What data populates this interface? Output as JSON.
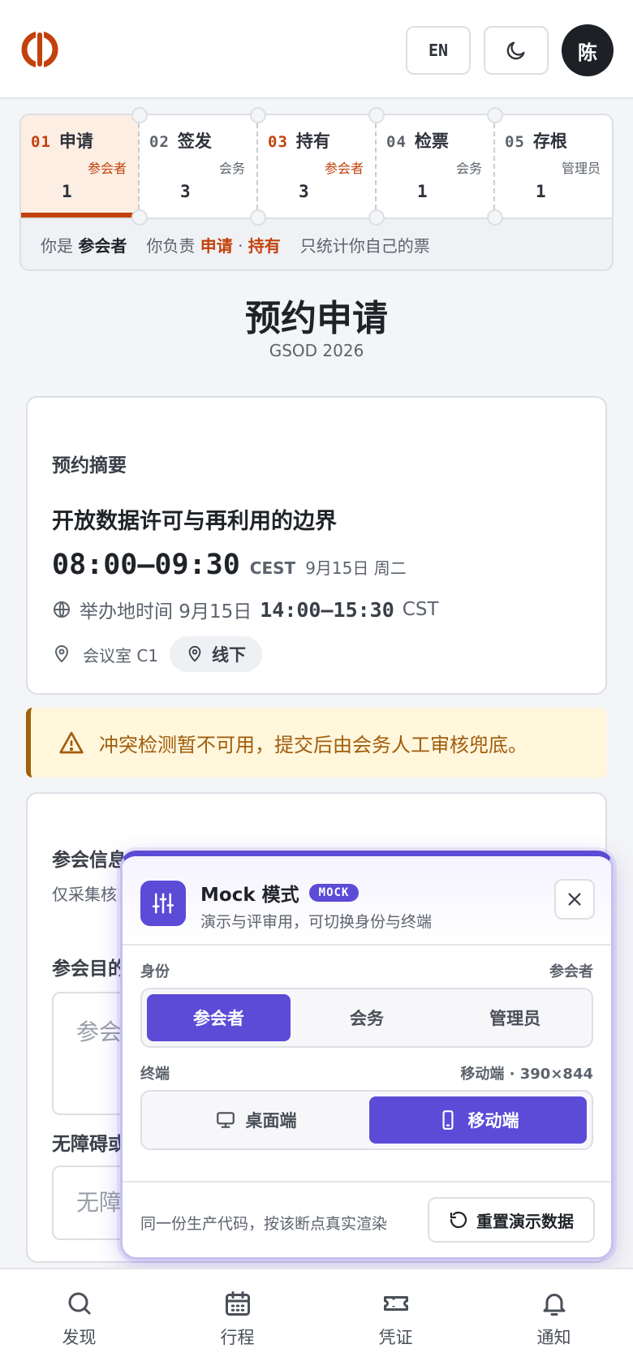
{
  "header": {
    "lang_label": "EN",
    "avatar_initial": "陈"
  },
  "stepper": {
    "steps": [
      {
        "num": "01",
        "name": "申请",
        "role": "参会者",
        "count": "1"
      },
      {
        "num": "02",
        "name": "签发",
        "role": "会务",
        "count": "3"
      },
      {
        "num": "03",
        "name": "持有",
        "role": "参会者",
        "count": "3"
      },
      {
        "num": "04",
        "name": "检票",
        "role": "会务",
        "count": "1"
      },
      {
        "num": "05",
        "name": "存根",
        "role": "管理员",
        "count": "1"
      }
    ],
    "you_are_prefix": "你是",
    "you_are_role": "参会者",
    "responsible_prefix": "你负责",
    "responsible_a": "申请",
    "dot": "·",
    "responsible_b": "持有",
    "note": "只统计你自己的票"
  },
  "page": {
    "title": "预约申请",
    "subtitle": "GSOD 2026"
  },
  "summary": {
    "label": "预约摘要",
    "session_title": "开放数据许可与再利用的边界",
    "time": "08:00–09:30",
    "tz": "CEST",
    "date": "9月15日 周二",
    "host_prefix": "举办地时间 9月15日",
    "host_time": "14:00–15:30",
    "host_tz": "CST",
    "room": "会议室 C1",
    "mode": "线下"
  },
  "warning": {
    "text": "冲突检测暂不可用，提交后由会务人工审核兜底。"
  },
  "form": {
    "section_label": "参会信息",
    "section_help": "仅采集核",
    "purpose_label": "参会目的",
    "purpose_placeholder": "参会",
    "access_label": "无障碍或",
    "access_placeholder": "无障"
  },
  "mock": {
    "title": "Mock 模式",
    "badge": "MOCK",
    "desc": "演示与评审用，可切换身份与终端",
    "identity_label": "身份",
    "identity_value": "参会者",
    "identity_options": [
      "参会者",
      "会务",
      "管理员"
    ],
    "terminal_label": "终端",
    "terminal_value": "移动端 · 390×844",
    "terminal_options": [
      "桌面端",
      "移动端"
    ],
    "foot_text": "同一份生产代码，按该断点真实渲染",
    "reset_label": "重置演示数据"
  },
  "nav": {
    "items": [
      "发现",
      "行程",
      "凭证",
      "通知"
    ]
  },
  "colors": {
    "accent": "#c2410c",
    "mock": "#5b4bd6",
    "warning": "#a16207"
  }
}
